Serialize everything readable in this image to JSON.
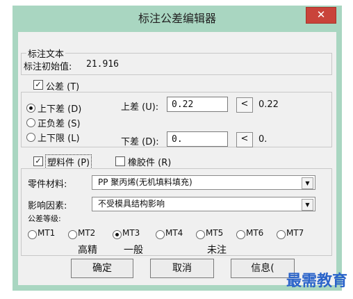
{
  "window": {
    "title": "标注公差编辑器"
  },
  "close_glyph": "✕",
  "dim_text": {
    "legend": "标注文本",
    "initial_label": "标注初始值:",
    "initial_value": "21.916"
  },
  "tolerance": {
    "checkbox_label": "公差 (T)",
    "checked": true,
    "modes": [
      {
        "label": "上下差 (D)",
        "selected": true
      },
      {
        "label": "正负差 (S)",
        "selected": false
      },
      {
        "label": "上下限 (L)",
        "selected": false
      }
    ],
    "upper": {
      "label": "上差 (U):",
      "value": "0.22",
      "button": "<",
      "readout": "0.22"
    },
    "lower": {
      "label": "下差 (D):",
      "value": "0.",
      "button": "<",
      "readout": "0."
    }
  },
  "material": {
    "plastic_label": "塑料件 (P)",
    "plastic_checked": true,
    "rubber_label": "橡胶件 (R)",
    "rubber_checked": false,
    "part_material_label": "零件材料:",
    "part_material_value": "PP 聚丙烯(无机填料填充)",
    "influence_label": "影响因素:",
    "influence_value": "不受模具结构影响",
    "grade_label": "公差等级:",
    "grades": [
      {
        "label": "MT1",
        "selected": false
      },
      {
        "label": "MT2",
        "selected": false
      },
      {
        "label": "MT3",
        "selected": true
      },
      {
        "label": "MT4",
        "selected": false
      },
      {
        "label": "MT5",
        "selected": false
      },
      {
        "label": "MT6",
        "selected": false
      },
      {
        "label": "MT7",
        "selected": false
      }
    ],
    "notes": {
      "high": "高精",
      "normal": "一般",
      "unnoted": "未注"
    }
  },
  "buttons": {
    "ok": "确定",
    "cancel": "取消",
    "info": "信息("
  },
  "watermark": "最需教育",
  "colors": {
    "frame": "#a9d6c1",
    "close": "#c9433a",
    "watermark": "#2a63c9"
  }
}
